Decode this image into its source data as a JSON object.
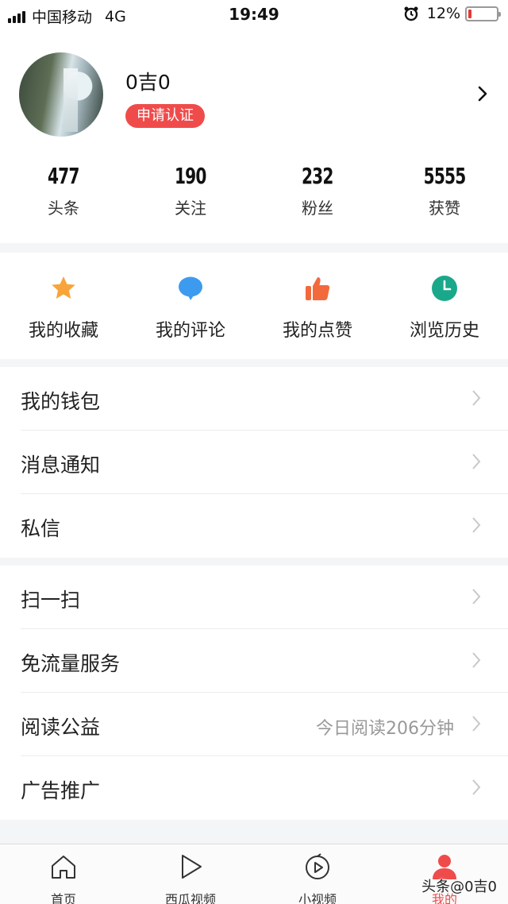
{
  "status_bar": {
    "carrier": "中国移动",
    "network": "4G",
    "time": "19:49",
    "battery": "12%",
    "battery_level": 0.12
  },
  "profile": {
    "username": "0吉0",
    "verify_label": "申请认证"
  },
  "stats": [
    {
      "value": "477",
      "label": "头条"
    },
    {
      "value": "190",
      "label": "关注"
    },
    {
      "value": "232",
      "label": "粉丝"
    },
    {
      "value": "5555",
      "label": "获赞"
    }
  ],
  "actions": [
    {
      "label": "我的收藏",
      "icon": "star-icon",
      "color": "#f7a53b"
    },
    {
      "label": "我的评论",
      "icon": "comment-icon",
      "color": "#3d9bef"
    },
    {
      "label": "我的点赞",
      "icon": "thumbs-up-icon",
      "color": "#f26a3c"
    },
    {
      "label": "浏览历史",
      "icon": "clock-icon",
      "color": "#1aa88a"
    }
  ],
  "menu_group_1": [
    {
      "label": "我的钱包"
    },
    {
      "label": "消息通知"
    },
    {
      "label": "私信"
    }
  ],
  "menu_group_2": [
    {
      "label": "扫一扫"
    },
    {
      "label": "免流量服务"
    },
    {
      "label": "阅读公益",
      "extra": "今日阅读206分钟"
    },
    {
      "label": "广告推广"
    }
  ],
  "tabbar": [
    {
      "label": "首页",
      "icon": "home-icon"
    },
    {
      "label": "西瓜视频",
      "icon": "play-icon"
    },
    {
      "label": "小视频",
      "icon": "short-video-icon"
    },
    {
      "label": "我的",
      "icon": "person-icon",
      "active": true
    }
  ],
  "watermark": "头条@0吉0",
  "colors": {
    "accent": "#f04b4b",
    "separator": "#f4f5f6"
  }
}
